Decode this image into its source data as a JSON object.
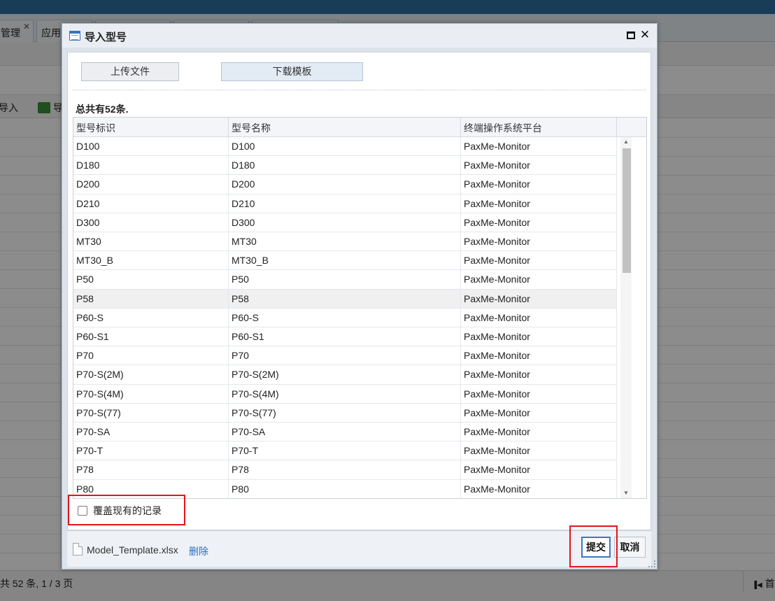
{
  "background": {
    "tabs": [
      {
        "label": "管理",
        "close": "✕"
      },
      {
        "label": "应用",
        "close": ""
      }
    ],
    "toolbar": [
      {
        "label": "导入"
      },
      {
        "label": "导"
      }
    ],
    "footer_summary": "共 52 条,  1 / 3 页",
    "footer_first": "首"
  },
  "dialog": {
    "title": "导入型号",
    "maximize_icon": "maximize-icon",
    "close_glyph": "✕",
    "upload_label": "上传文件",
    "download_label": "下载模板",
    "total_text": "总共有52条.",
    "columns": [
      "型号标识",
      "型号名称",
      "终端操作系统平台"
    ],
    "rows": [
      [
        "D100",
        "D100",
        "PaxMe-Monitor"
      ],
      [
        "D180",
        "D180",
        "PaxMe-Monitor"
      ],
      [
        "D200",
        "D200",
        "PaxMe-Monitor"
      ],
      [
        "D210",
        "D210",
        "PaxMe-Monitor"
      ],
      [
        "D300",
        "D300",
        "PaxMe-Monitor"
      ],
      [
        "MT30",
        "MT30",
        "PaxMe-Monitor"
      ],
      [
        "MT30_B",
        "MT30_B",
        "PaxMe-Monitor"
      ],
      [
        "P50",
        "P50",
        "PaxMe-Monitor"
      ],
      [
        "P58",
        "P58",
        "PaxMe-Monitor"
      ],
      [
        "P60-S",
        "P60-S",
        "PaxMe-Monitor"
      ],
      [
        "P60-S1",
        "P60-S1",
        "PaxMe-Monitor"
      ],
      [
        "P70",
        "P70",
        "PaxMe-Monitor"
      ],
      [
        "P70-S(2M)",
        "P70-S(2M)",
        "PaxMe-Monitor"
      ],
      [
        "P70-S(4M)",
        "P70-S(4M)",
        "PaxMe-Monitor"
      ],
      [
        "P70-S(77)",
        "P70-S(77)",
        "PaxMe-Monitor"
      ],
      [
        "P70-SA",
        "P70-SA",
        "PaxMe-Monitor"
      ],
      [
        "P70-T",
        "P70-T",
        "PaxMe-Monitor"
      ],
      [
        "P78",
        "P78",
        "PaxMe-Monitor"
      ],
      [
        "P80",
        "P80",
        "PaxMe-Monitor"
      ]
    ],
    "highlighted_row": 8,
    "overwrite_label": "覆盖现有的记录",
    "overwrite_checked": false,
    "file_name": "Model_Template.xlsx",
    "delete_label": "删除",
    "submit_label": "提交",
    "cancel_label": "取消"
  },
  "colors": {
    "annotation": "#e4141b",
    "link": "#2a6fc9",
    "submit_border": "#3a78c6"
  }
}
